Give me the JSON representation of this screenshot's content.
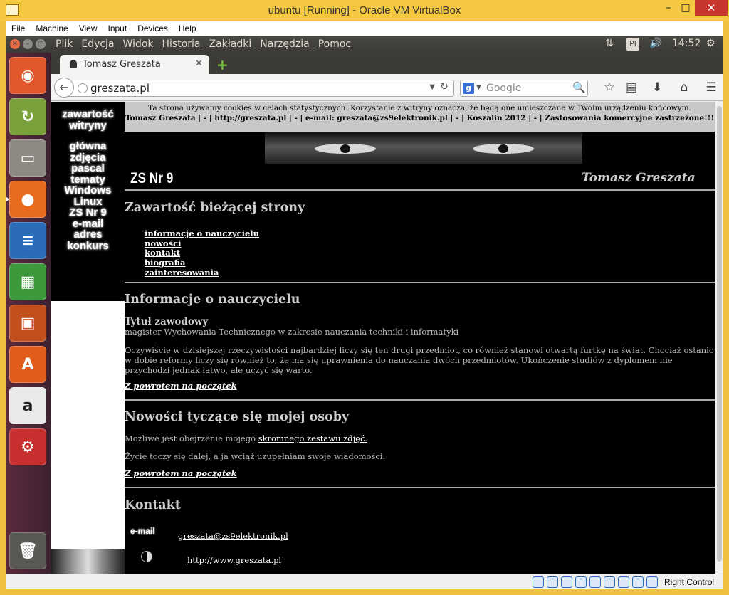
{
  "host_window": {
    "title": "ubuntu [Running] - Oracle VM VirtualBox",
    "controls": {
      "minimize": "–",
      "maximize": "□",
      "close": "✕"
    }
  },
  "vbox_menu": [
    "File",
    "Machine",
    "View",
    "Input",
    "Devices",
    "Help"
  ],
  "ubuntu_panel": {
    "app_menu": [
      "Plik",
      "Edycja",
      "Widok",
      "Historia",
      "Zakładki",
      "Narzędzia",
      "Pomoc"
    ],
    "keyboard_layout": "Pl",
    "clock": "14:52"
  },
  "launcher": {
    "items": [
      {
        "name": "dash-home",
        "icon": "ubuntu-logo-icon",
        "color": "#e0582c"
      },
      {
        "name": "software-updater",
        "icon": "updater-icon",
        "color": "#7aa03c"
      },
      {
        "name": "files",
        "icon": "file-cabinet-icon",
        "color": "#8d8a84"
      },
      {
        "name": "firefox",
        "icon": "firefox-icon",
        "color": "#e86a1c",
        "active": true
      },
      {
        "name": "libreoffice-writer",
        "icon": "writer-icon",
        "color": "#2b6cb8"
      },
      {
        "name": "libreoffice-calc",
        "icon": "calc-icon",
        "color": "#3c9a3c"
      },
      {
        "name": "libreoffice-impress",
        "icon": "impress-icon",
        "color": "#c2501e"
      },
      {
        "name": "ubuntu-software-center",
        "icon": "shopping-bag-icon",
        "color": "#e25c1c"
      },
      {
        "name": "amazon",
        "icon": "amazon-icon",
        "color": "#e9e9e9"
      },
      {
        "name": "system-settings",
        "icon": "settings-wrench-icon",
        "color": "#c83030"
      },
      {
        "name": "trash",
        "icon": "trash-icon",
        "color": "#5a5855"
      }
    ]
  },
  "browser": {
    "tab_title": "Tomasz Greszata",
    "url": "greszata.pl",
    "search_placeholder": "Google",
    "search_engine_letter": "g"
  },
  "page": {
    "sidebar_heading": "zawartość witryny",
    "sidebar_links": [
      "główna",
      "zdjęcia",
      "pascal",
      "tematy",
      "Windows",
      "Linux",
      "ZS Nr 9",
      "e-mail",
      "adres",
      "konkurs"
    ],
    "cookie_notice": "Ta strona używamy cookies w celach statystycznych. Korzystanie z witryny oznacza, że będą one umieszczane w Twoim urządzeniu końcowym.",
    "cookie_footer": "Tomasz Greszata | - | http://greszata.pl | - | e-mail: greszata@zs9elektronik.pl | - | Koszalin 2012 | - | Zastosowania komercyjne zastrzeżone!!!",
    "school_label": "ZS Nr 9",
    "author": "Tomasz Greszata",
    "toc_heading": "Zawartość bieżącej strony",
    "toc_links": [
      "informacje o nauczycielu",
      "nowości",
      "kontakt",
      "biografia",
      "zainteresowania"
    ],
    "info_heading": "Informacje o nauczycielu",
    "title_label": "Tytuł zawodowy",
    "title_value": "magister Wychowania Technicznego w zakresie nauczania techniki i informatyki",
    "info_paragraph": "Oczywiście w dzisiejszej rzeczywistości najbardziej liczy się ten drugi przedmiot, co również stanowi otwartą furtkę na świat. Chociaż ostanio w dobie reformy liczy się również to, że ma się uprawnienia do nauczania dwóch przedmiotów. Ukończenie studiów z dyplomem nie przychodzi jednak łatwo, ale uczyć się warto.",
    "back_to_top": "Z powrotem na początek",
    "news_heading": "Nowości tyczące się mojej osoby",
    "news_text_before": "Możliwe jest obejrzenie mojego ",
    "news_link": "skromnego zestawu zdjęć.",
    "news_paragraph2": "Życie toczy się dalej, a ja wciąż uzupełniam swoje wiadomości.",
    "contact_heading": "Kontakt",
    "email_label": "e-mail",
    "email": "greszata@zs9elektronik.pl",
    "website": "http://www.greszata.pl"
  },
  "status_bar": {
    "icons": [
      "hdd-icon",
      "optical-drive-icon",
      "audio-icon",
      "network-icon",
      "usb-icon",
      "shared-folder-icon",
      "display-icon",
      "video-capture-icon",
      "cpu-icon",
      "mouse-integration-icon",
      "keyboard-icon"
    ],
    "host_key": "Right Control"
  }
}
